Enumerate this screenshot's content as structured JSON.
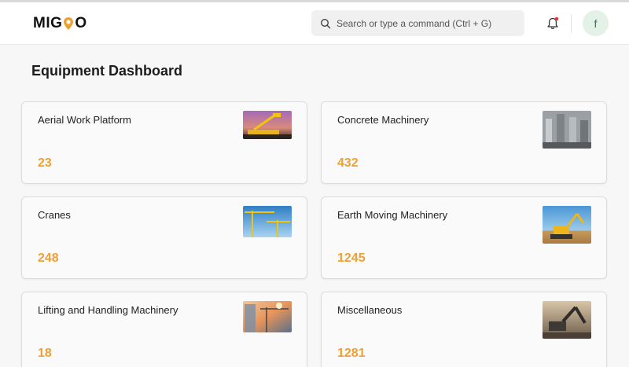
{
  "app": {
    "logo_text_left": "MIG",
    "logo_text_right": "O"
  },
  "header": {
    "search_placeholder": "Search or type a command (Ctrl + G)",
    "avatar_initial": "f"
  },
  "page": {
    "title": "Equipment Dashboard"
  },
  "colors": {
    "accent": "#f0a031",
    "avatar_bg": "#e3f1e6",
    "notification_dot": "#e53935"
  },
  "cards": [
    {
      "name": "Aerial Work Platform",
      "count": "23",
      "image": "aerial-work-platform-photo"
    },
    {
      "name": "Concrete Machinery",
      "count": "432",
      "image": "concrete-machinery-photo"
    },
    {
      "name": "Cranes",
      "count": "248",
      "image": "cranes-photo"
    },
    {
      "name": "Earth Moving Machinery",
      "count": "1245",
      "image": "earth-moving-machinery-photo"
    },
    {
      "name": "Lifting and Handling Machinery",
      "count": "18",
      "image": "lifting-handling-photo"
    },
    {
      "name": "Miscellaneous",
      "count": "1281",
      "image": "miscellaneous-photo"
    }
  ]
}
